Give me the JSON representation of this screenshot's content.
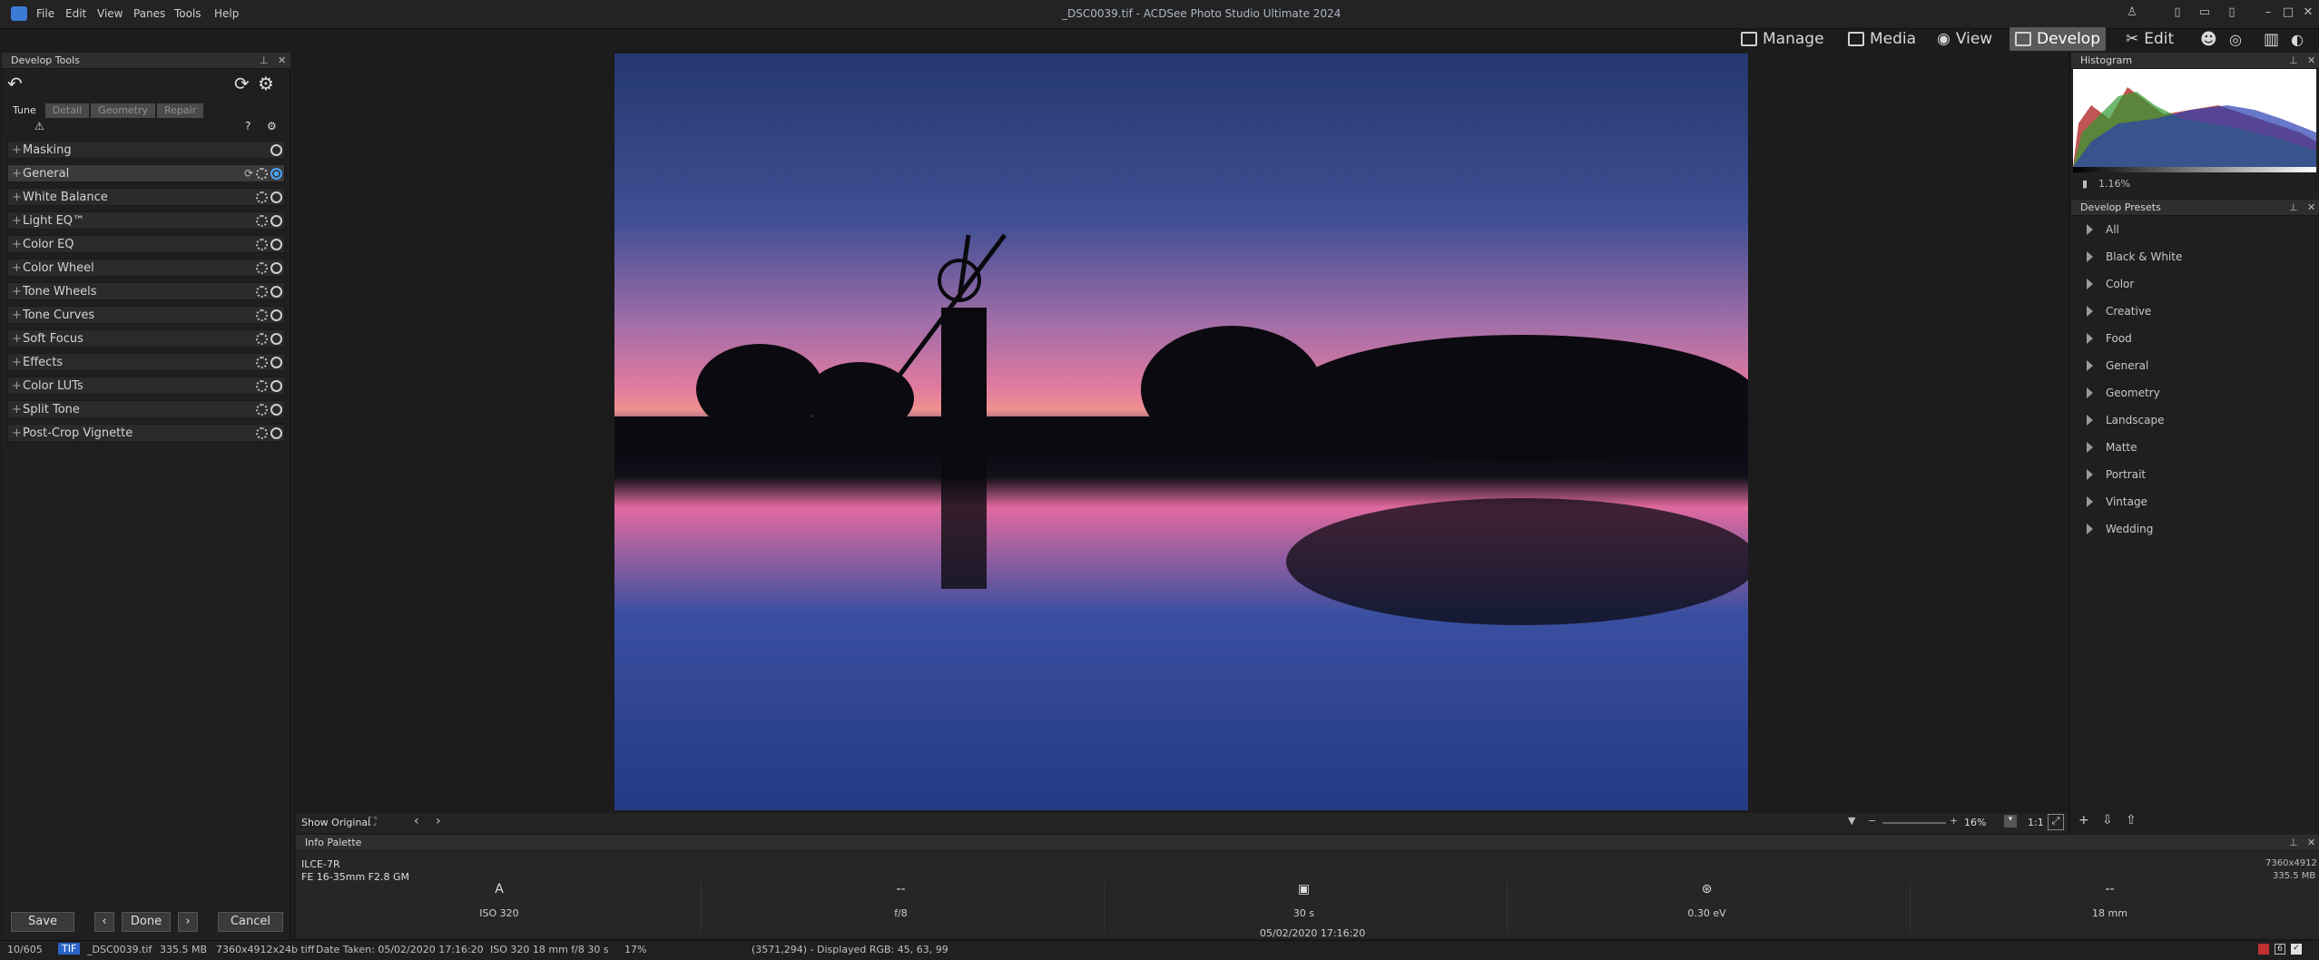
{
  "window": {
    "title": "_DSC0039.tif - ACDSee Photo Studio Ultimate 2024"
  },
  "menu": [
    "File",
    "Edit",
    "View",
    "Panes",
    "Tools",
    "Help"
  ],
  "modes": [
    {
      "label": "Manage",
      "active": false
    },
    {
      "label": "Media",
      "active": false
    },
    {
      "label": "View",
      "active": false
    },
    {
      "label": "Develop",
      "active": true
    },
    {
      "label": "Edit",
      "active": false
    }
  ],
  "left_panel": {
    "title": "Develop Tools",
    "tabs": [
      "Tune",
      "Detail",
      "Geometry",
      "Repair"
    ],
    "tools": [
      "Masking",
      "General",
      "White Balance",
      "Light EQ™",
      "Color EQ",
      "Color Wheel",
      "Tone Wheels",
      "Tone Curves",
      "Soft Focus",
      "Effects",
      "Color LUTs",
      "Split Tone",
      "Post-Crop Vignette"
    ],
    "buttons": {
      "save": "Save",
      "done": "Done",
      "cancel": "Cancel"
    }
  },
  "histogram": {
    "title": "Histogram",
    "clip": "1.16%"
  },
  "presets": {
    "title": "Develop Presets",
    "items": [
      "All",
      "Black & White",
      "Color",
      "Creative",
      "Food",
      "General",
      "Geometry",
      "Landscape",
      "Matte",
      "Portrait",
      "Vintage",
      "Wedding"
    ]
  },
  "viewbar": {
    "show_original": "Show Original",
    "zoom": "16%",
    "ratio": "1:1"
  },
  "info": {
    "title": "Info Palette",
    "camera": "ILCE-7R",
    "lens": "FE 16-35mm F2.8 GM",
    "dimensions": "7360x4912",
    "size": "335.5 MB",
    "columns": [
      {
        "sym": "A",
        "val": "ISO 320"
      },
      {
        "sym": "--",
        "val": "f/8"
      },
      {
        "sym": "▣",
        "val": "30 s"
      },
      {
        "sym": "⊛",
        "val": "0.30 eV"
      },
      {
        "sym": "--",
        "val": "18 mm"
      }
    ],
    "date": "05/02/2020 17:16:20"
  },
  "status": {
    "index": "10/605",
    "format": "TIF",
    "filename": "_DSC0039.tif",
    "filesize": "335.5 MB",
    "dims": "7360x4912x24b tiff",
    "date_taken": "Date Taken: 05/02/2020 17:16:20",
    "exif": "ISO 320   18 mm   f/8   30 s",
    "zoom": "17%",
    "pixel": "(3571,294) - Displayed RGB: 45, 63, 99"
  },
  "colors": {
    "accent": "#4aa3ff",
    "active_mode": "#5a5a5a",
    "sky_top": "#24386e",
    "sky_pink": "#e07aa0"
  }
}
